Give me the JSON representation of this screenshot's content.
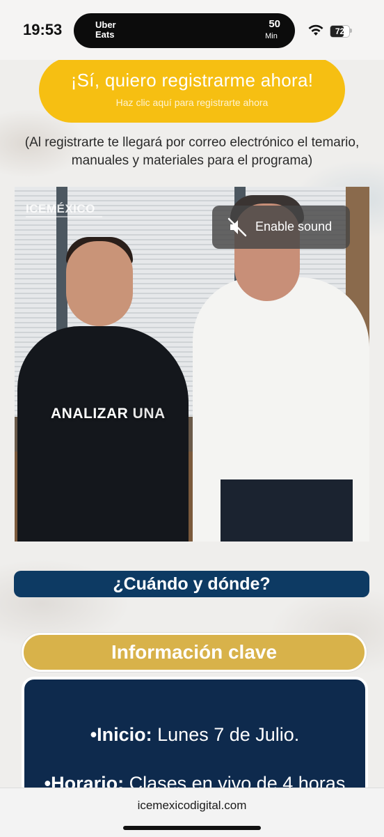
{
  "status_bar": {
    "time": "19:53",
    "live_activity": {
      "app_line1": "Uber",
      "app_line2": "Eats",
      "eta_value": "50",
      "eta_unit": "Min"
    },
    "battery_percent": "72"
  },
  "cta": {
    "title": "¡Sí, quiero registrarme ahora!",
    "subtitle": "Haz clic aquí para registrarte ahora",
    "color": "#f6bf12"
  },
  "note": "(Al registrarte te llegará por correo electrónico el temario, manuales y materiales para el programa)",
  "video": {
    "logo_text": "ICEMÉXICO",
    "caption_main": "ANALIZAR",
    "caption_dim": "UNA",
    "sound_button_label": "Enable sound",
    "sound_icon": "speaker-muted-icon"
  },
  "section_heading": {
    "label": "¿Cuándo y dónde?",
    "color": "#0d3a63"
  },
  "key_info": {
    "title": "Información clave",
    "title_color": "#d8b24a",
    "box_color": "#0e2a4d",
    "items": [
      {
        "label": "•Inicio:",
        "value": " Lunes 7 de Julio."
      },
      {
        "label": "•Horario:",
        "value": " Clases en vivo de 4 horas"
      }
    ]
  },
  "browser": {
    "url": "icemexicodigital.com"
  }
}
